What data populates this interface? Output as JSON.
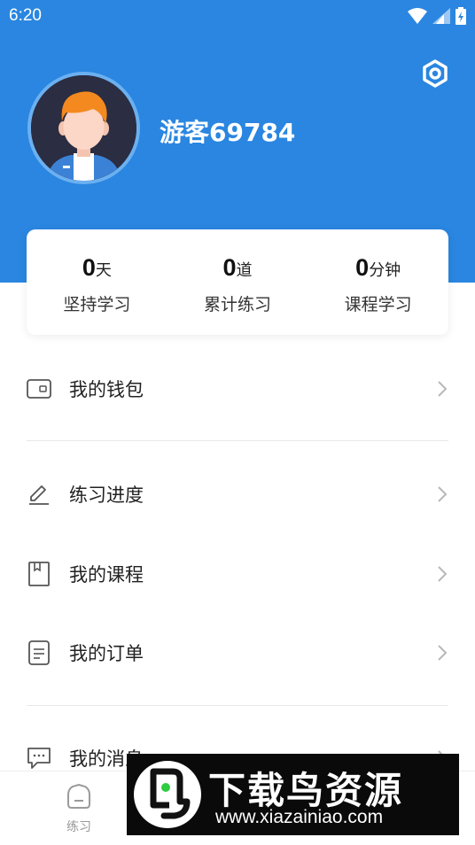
{
  "status_bar": {
    "time": "6:20"
  },
  "profile": {
    "username": "游客69784"
  },
  "stats": [
    {
      "value": "0",
      "unit": "天",
      "label": "坚持学习"
    },
    {
      "value": "0",
      "unit": "道",
      "label": "累计练习"
    },
    {
      "value": "0",
      "unit": "分钟",
      "label": "课程学习"
    }
  ],
  "menu": {
    "wallet": "我的钱包",
    "progress": "练习进度",
    "courses": "我的课程",
    "orders": "我的订单",
    "messages": "我的消息"
  },
  "tabbar": {
    "practice": "练习"
  },
  "watermark": {
    "title": "下载鸟资源",
    "url": "www.xiazainiao.com"
  },
  "colors": {
    "primary": "#2a86e0",
    "background": "#ffffff"
  }
}
